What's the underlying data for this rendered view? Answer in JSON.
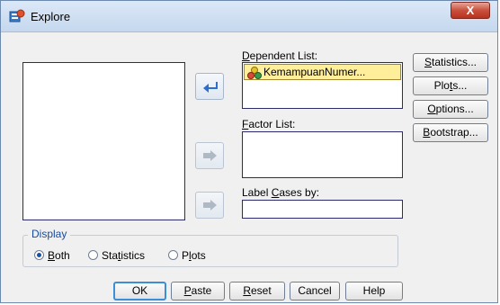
{
  "window": {
    "title": "Explore",
    "close_label": "X"
  },
  "variables_list": {
    "items": []
  },
  "dependent_list": {
    "label_pre": "",
    "label_key": "D",
    "label_post": "ependent List:",
    "items": [
      "KemampuanNumer..."
    ]
  },
  "factor_list": {
    "label_pre": "",
    "label_key": "F",
    "label_post": "actor List:",
    "items": []
  },
  "label_cases": {
    "label_pre": "Label ",
    "label_key": "C",
    "label_post": "ases by:",
    "value": ""
  },
  "side_buttons": {
    "statistics": {
      "pre": "",
      "key": "S",
      "post": "tatistics..."
    },
    "plots": {
      "pre": "Plo",
      "key": "t",
      "post": "s..."
    },
    "options": {
      "pre": "",
      "key": "O",
      "post": "ptions..."
    },
    "bootstrap": {
      "pre": "",
      "key": "B",
      "post": "ootstrap..."
    }
  },
  "display": {
    "legend": "Display",
    "selected": "both",
    "both": {
      "pre": "",
      "key": "B",
      "post": "oth"
    },
    "statistics": {
      "pre": "Sta",
      "key": "t",
      "post": "istics"
    },
    "plots": {
      "pre": "P",
      "key": "l",
      "post": "ots"
    }
  },
  "bottom_buttons": {
    "ok": {
      "pre": "OK",
      "key": "",
      "post": ""
    },
    "paste": {
      "pre": "",
      "key": "P",
      "post": "aste"
    },
    "reset": {
      "pre": "",
      "key": "R",
      "post": "eset"
    },
    "cancel": {
      "pre": "Cancel",
      "key": "",
      "post": ""
    },
    "help": {
      "pre": "Help",
      "key": "",
      "post": ""
    }
  },
  "colors": {
    "selected_item_bg": "#ffef9a",
    "legend_text": "#1a4a9a",
    "default_button_border": "#3b8fd8",
    "close_button": "#c9503e"
  },
  "icons": {
    "title": "spss-dialog-icon",
    "variable": "scale-variable-icon",
    "move_back": "arrow-left-icon",
    "move_right": "arrow-right-icon"
  }
}
